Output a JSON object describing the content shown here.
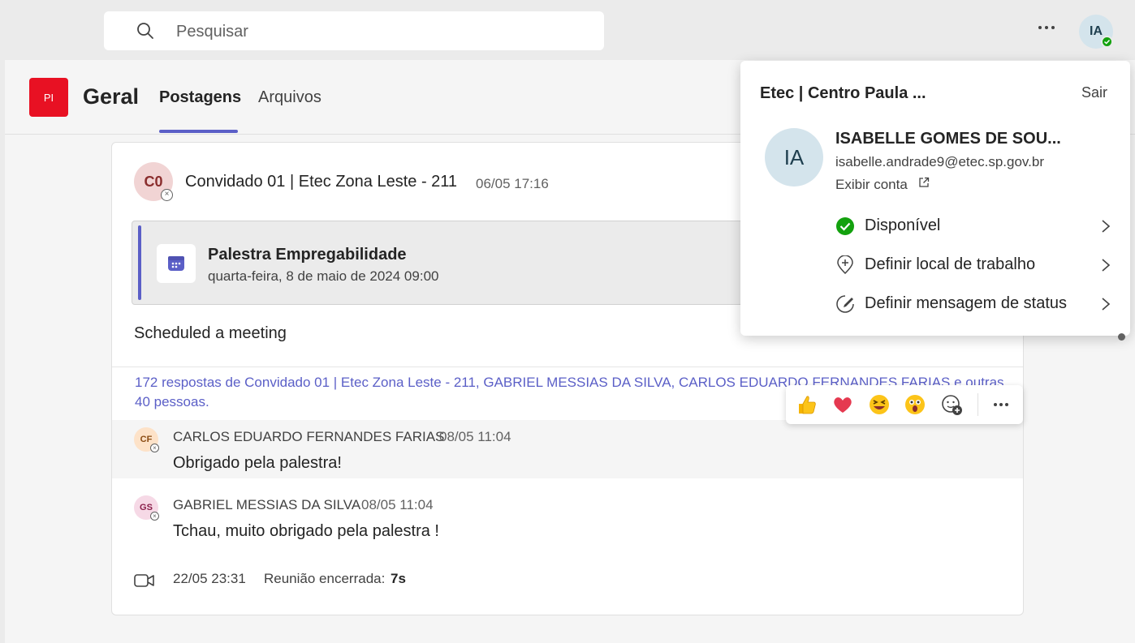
{
  "search": {
    "placeholder": "Pesquisar"
  },
  "user": {
    "initials": "IA",
    "presence_color": "#13a10e"
  },
  "team": {
    "logo_text": "PI",
    "logo_color": "#e81123",
    "channel": "Geral"
  },
  "tabs": [
    {
      "label": "Postagens",
      "active": true
    },
    {
      "label": "Arquivos",
      "active": false
    }
  ],
  "accent": "#5b5fc7",
  "post": {
    "author_initials": "C0",
    "author": "Convidado 01 | Etec Zona Leste - 211",
    "time": "06/05 17:16",
    "meeting": {
      "title": "Palestra Empregabilidade",
      "date": "quarta-feira, 8 de maio de 2024 09:00"
    },
    "body": "Scheduled a meeting",
    "replies_summary": "172 respostas de Convidado 01 | Etec Zona Leste - 211, GABRIEL MESSIAS DA SILVA, CARLOS EDUARDO FERNANDES FARIAS e outras 40 pessoas."
  },
  "replies": [
    {
      "initials": "CF",
      "author": "CARLOS EDUARDO FERNANDES FARIAS",
      "time": "08/05 11:04",
      "text": "Obrigado pela palestra!"
    },
    {
      "initials": "GS",
      "author": "GABRIEL MESSIAS DA SILVA",
      "time": "08/05 11:04",
      "text": "Tchau, muito obrigado pela palestra !"
    }
  ],
  "meeting_end": {
    "time": "22/05 23:31",
    "label": "Reunião encerrada:",
    "duration": "7s"
  },
  "reactions": [
    "like-icon",
    "heart-icon",
    "laugh-icon",
    "surprised-icon",
    "add-reaction-icon"
  ],
  "profile": {
    "org": "Etec | Centro Paula ...",
    "signout": "Sair",
    "initials": "IA",
    "name": "ISABELLE GOMES DE SOU...",
    "email": "isabelle.andrade9@etec.sp.gov.br",
    "view_account": "Exibir conta",
    "menu": [
      {
        "label": "Disponível",
        "icon": "available-check-icon"
      },
      {
        "label": "Definir local de trabalho",
        "icon": "location-add-icon"
      },
      {
        "label": "Definir mensagem de status",
        "icon": "status-message-icon"
      }
    ]
  }
}
